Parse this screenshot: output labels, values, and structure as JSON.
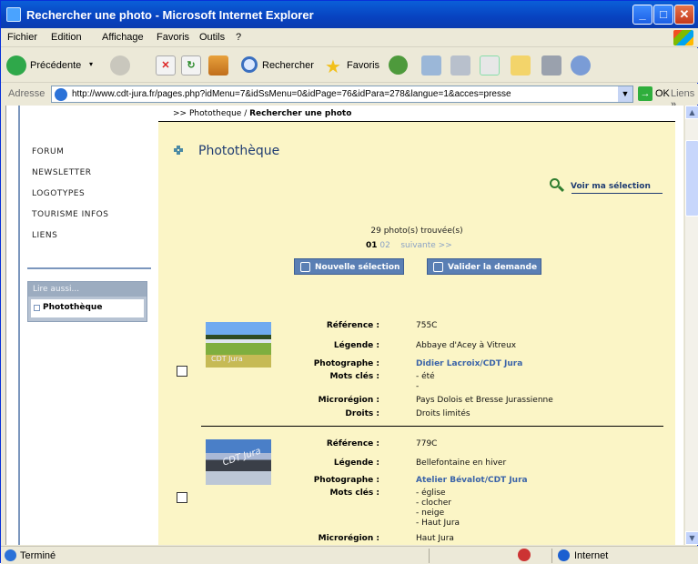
{
  "window": {
    "title": "Rechercher une photo - Microsoft Internet Explorer",
    "minimize": "_",
    "maximize": "□",
    "close": "✕"
  },
  "menu": [
    "Fichier",
    "Edition",
    "Affichage",
    "Favoris",
    "Outils",
    "?"
  ],
  "toolbar": {
    "back": "Précédente",
    "search": "Rechercher",
    "favorites": "Favoris"
  },
  "address": {
    "label": "Adresse",
    "url": "http://www.cdt-jura.fr/pages.php?idMenu=7&idSsMenu=0&idPage=76&idPara=278&langue=1&acces=presse",
    "go": "OK",
    "links": "Liens",
    "links_chevron": "»"
  },
  "breadcrumb": {
    "prefix": ">> Phototheque /",
    "current": "Rechercher une photo"
  },
  "nav": [
    "FORUM",
    "NEWSLETTER",
    "LOGOTYPES",
    "TOURISME INFOS",
    "LIENS"
  ],
  "lire_aussi": {
    "heading": "Lire aussi...",
    "item": "Photothèque"
  },
  "page": {
    "title": "Photothèque",
    "voir_selection": "Voir ma sélection",
    "found": "29 photo(s) trouvée(s)",
    "pager": {
      "current": "01",
      "other": "02",
      "next": "suivante >>"
    },
    "btn_nouvelle": "Nouvelle sélection",
    "btn_valider": "Valider la demande"
  },
  "labels": {
    "reference": "Référence :",
    "legende": "Légende :",
    "photographe": "Photographe :",
    "mots_cles": "Mots clés :",
    "microregion": "Microrégion :",
    "droits": "Droits :"
  },
  "photos": [
    {
      "caption": "CDT Jura",
      "reference": "755C",
      "legende": "Abbaye d'Acey à Vitreux",
      "photographe": "Didier Lacroix/CDT Jura",
      "mots_cles": [
        "- été",
        "-"
      ],
      "microregion": "Pays Dolois et Bresse Jurassienne",
      "droits": "Droits limités"
    },
    {
      "caption": "CDT Jura",
      "reference": "779C",
      "legende": "Bellefontaine en hiver",
      "photographe": "Atelier Bévalot/CDT Jura",
      "mots_cles": [
        "- église",
        "- clocher",
        "- neige",
        "- Haut Jura"
      ],
      "microregion": "Haut Jura"
    }
  ],
  "status": {
    "text": "Terminé",
    "zone": "Internet"
  },
  "scroll": {
    "up": "▲",
    "down": "▼"
  }
}
